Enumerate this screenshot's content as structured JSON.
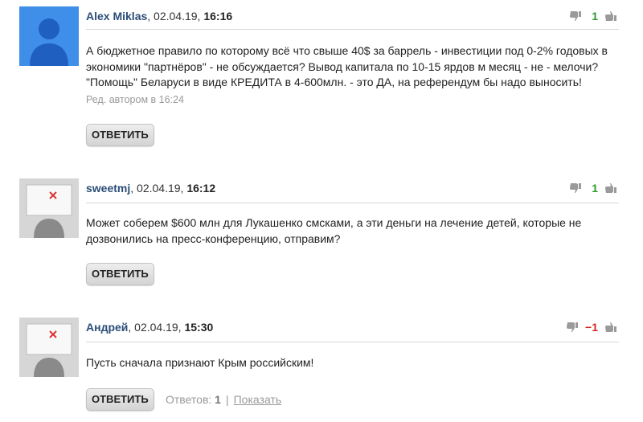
{
  "colors": {
    "author": "#2a4d78",
    "positive": "#2e9a2e",
    "negative": "#d42626",
    "muted": "#999999",
    "avatar_default": "#3f8ee8"
  },
  "icons": {
    "thumb_down": "thumb-down-icon",
    "thumb_up": "thumb-up-icon",
    "avatar_placeholder": "user-silhouette-icon",
    "broken_image": "broken-image-icon"
  },
  "comments": [
    {
      "author": "Alex Miklas",
      "date": ", 02.04.19, ",
      "time": "16:16",
      "score": "1",
      "text": "А бюджетное правило по которому всё что свыше 40$ за баррель - инвестиции под 0-2% годовых в экономики \"партнёров\" - не обсуждается? Вывод капитала по 10-15 ярдов м месяц - не - мелочи? \"Помощь\" Беларуси в виде КРЕДИТА в 4-600млн. - это ДА, на референдум бы надо выносить!",
      "edited": "Ред. автором в 16:24",
      "reply_label": "ОТВЕТИТЬ"
    },
    {
      "author": "sweetmj",
      "date": ", 02.04.19, ",
      "time": "16:12",
      "score": "1",
      "text": "Может соберем $600 млн для Лукашенко смсками, а эти деньги на лечение детей, которые не дозвонились на пресс-конференцию, отправим?",
      "reply_label": "ОТВЕТИТЬ"
    },
    {
      "author": "Андрей",
      "date": ", 02.04.19, ",
      "time": "15:30",
      "score": "−1",
      "text": "Пусть сначала признают Крым российским!",
      "reply_label": "ОТВЕТИТЬ",
      "replies_label": "Ответов: ",
      "replies_count": "1",
      "separator": "|",
      "show_label": "Показать"
    }
  ]
}
